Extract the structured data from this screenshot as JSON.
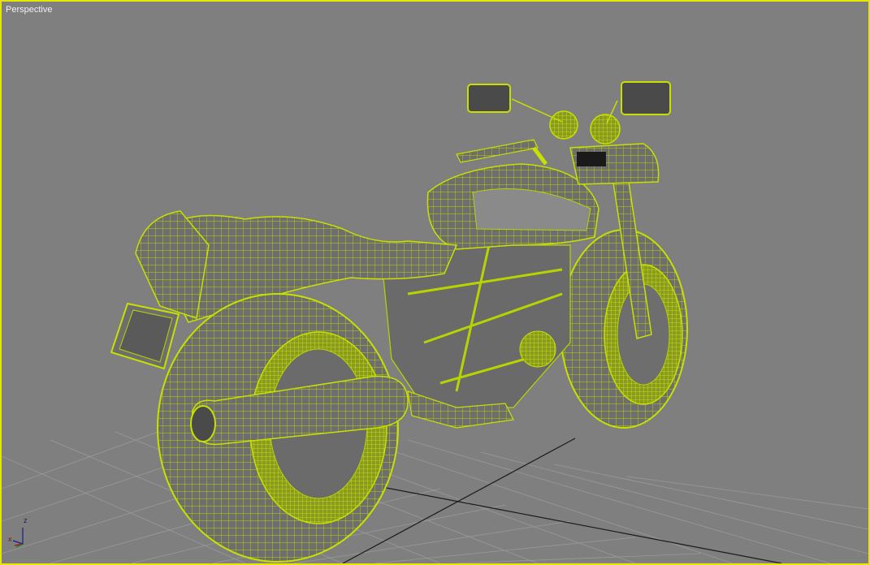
{
  "viewport": {
    "label": "Perspective",
    "border_color": "#e6e600",
    "background_color": "#7f7f7f"
  },
  "scene": {
    "object": "motorcycle-wireframe",
    "wire_color": "#b8d400",
    "shaded_color": "#777777"
  },
  "axis_gizmo": {
    "z_label": "z",
    "x_label": "x"
  }
}
